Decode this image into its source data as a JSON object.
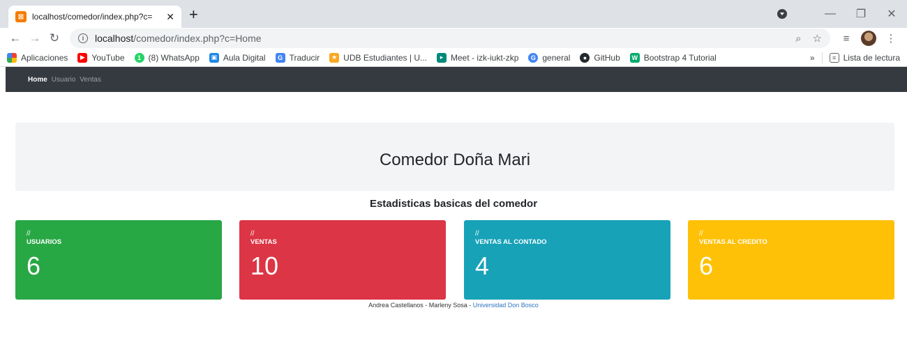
{
  "browser": {
    "tab_title": "localhost/comedor/index.php?c=",
    "favicon_glyph": "xampp-icon",
    "url_host": "localhost",
    "url_path": "/comedor/index.php?c=Home",
    "bookmarks": [
      {
        "label": "Aplicaciones",
        "icon": "apps-grid-icon",
        "color": "#4285f4"
      },
      {
        "label": "YouTube",
        "icon": "youtube-icon",
        "color": "#ff0000"
      },
      {
        "label": "(8) WhatsApp",
        "icon": "whatsapp-icon",
        "color": "#25d366"
      },
      {
        "label": "Aula Digital",
        "icon": "aula-digital-icon",
        "color": "#1e88e5"
      },
      {
        "label": "Traducir",
        "icon": "translate-icon",
        "color": "#4285f4"
      },
      {
        "label": "UDB Estudiantes | U...",
        "icon": "udb-icon",
        "color": "#f9a825"
      },
      {
        "label": "Meet - izk-iukt-zkp",
        "icon": "meet-icon",
        "color": "#00897b"
      },
      {
        "label": "general",
        "icon": "general-icon",
        "color": "#4285f4"
      },
      {
        "label": "GitHub",
        "icon": "github-icon",
        "color": "#24292e"
      },
      {
        "label": "Bootstrap 4 Tutorial",
        "icon": "w3schools-icon",
        "color": "#04aa6d"
      }
    ],
    "overflow_label": "»",
    "reading_list_label": "Lista de lectura"
  },
  "nav": {
    "items": [
      {
        "label": "Home",
        "active": true
      },
      {
        "label": "Usuario",
        "active": false
      },
      {
        "label": "Ventas",
        "active": false
      }
    ]
  },
  "main": {
    "title": "Comedor Doña Mari",
    "subtitle": "Estadisticas basicas del comedor"
  },
  "cards": [
    {
      "prefix": "//",
      "label": "USUARIOS",
      "value": "6",
      "color": "#28a745"
    },
    {
      "prefix": "//",
      "label": "VENTAS",
      "value": "10",
      "color": "#dc3545"
    },
    {
      "prefix": "//",
      "label": "VENTAS AL CONTADO",
      "value": "4",
      "color": "#17a2b8"
    },
    {
      "prefix": "//",
      "label": "VENTAS AL CREDITO",
      "value": "6",
      "color": "#ffc107"
    }
  ],
  "footer": {
    "text": "Andrea Castellanos - Marleny Sosa - ",
    "link": "Universidad Don Bosco"
  }
}
